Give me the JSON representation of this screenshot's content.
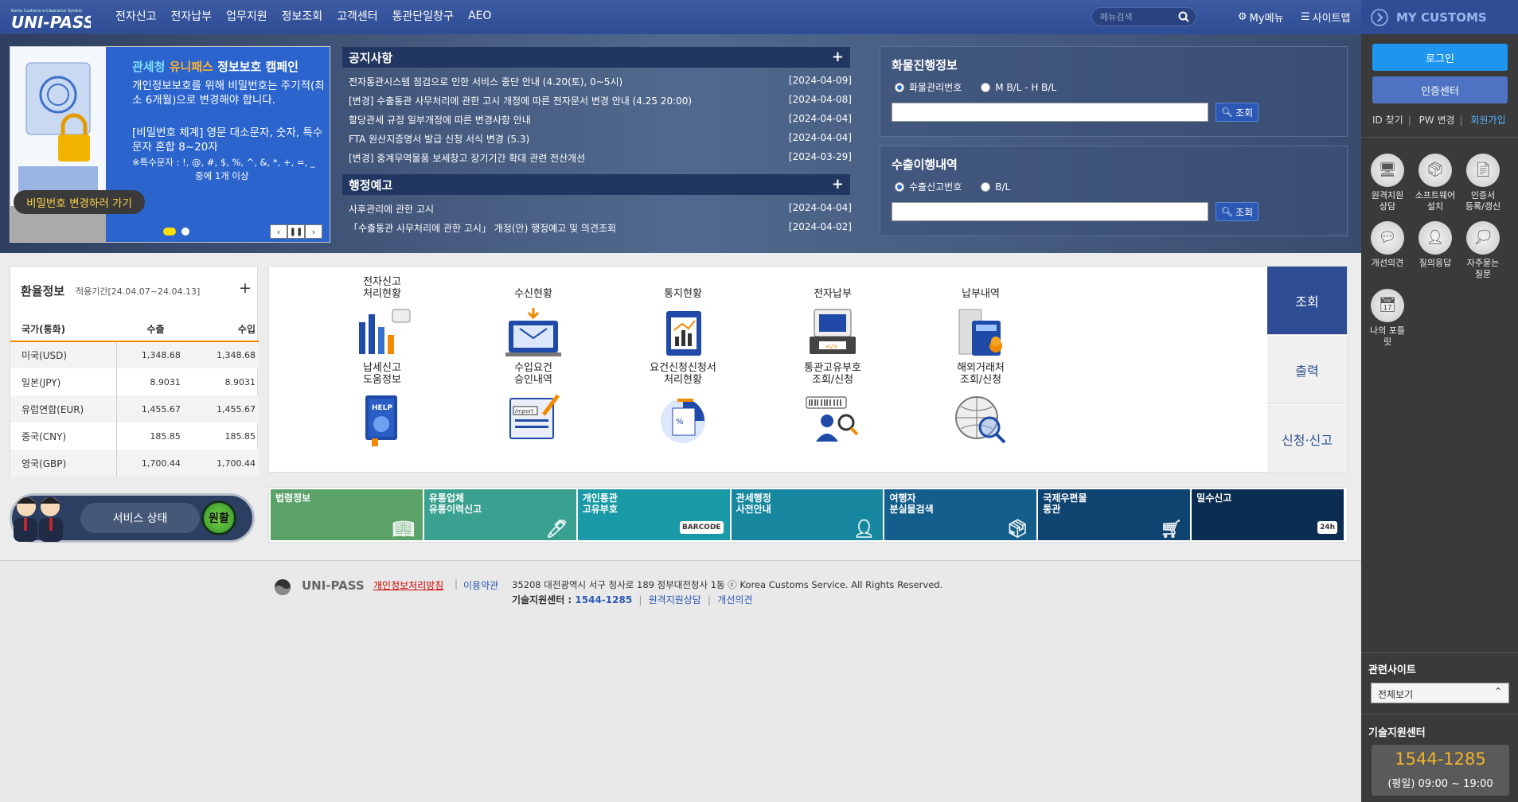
{
  "header": {
    "nav": [
      "전자신고",
      "전자납부",
      "업무지원",
      "정보조회",
      "고객센터",
      "통관단일창구",
      "AEO"
    ],
    "search_placeholder": "메뉴검색",
    "mymenu": "My메뉴",
    "sitemap": "사이트맵"
  },
  "banner": {
    "title_a": "관세청",
    "title_b": "유니패스",
    "title_c": "정보보호 캠페인",
    "line1": "개인정보보호를 위해 비밀번호는 주기적(최소 6개월)으로 변경해야 합니다.",
    "line2": "[비밀번호 체계] 영문 대소문자, 숫자, 특수문자 혼합 8~20자",
    "line3": "※특수문자 : !, @, #, $, %, ^, &, *, +, =, _",
    "line4": "중에 1개 이상",
    "cta": "비밀번호 변경하러 가기"
  },
  "notices": {
    "title": "공지사항",
    "items": [
      {
        "text": "전자통관시스템 점검으로 인한 서비스 중단 안내 (4.20(토), 0~5시)",
        "date": "[2024-04-09]"
      },
      {
        "text": "[변경] 수출통관 사무처리에 관한 고시 개정에 따른 전자문서 변경 안내 (4.25 20:00)",
        "date": "[2024-04-08]"
      },
      {
        "text": "할당관세 규정 일부개정에 따른 변경사항 안내",
        "date": "[2024-04-04]"
      },
      {
        "text": "FTA 원산지증명서 발급 신청 서식 변경 (5.3)",
        "date": "[2024-04-04]"
      },
      {
        "text": "[변경] 중계무역물품 보세창고 장기기간 확대 관련 전산개선",
        "date": "[2024-03-29]"
      }
    ]
  },
  "admin_notice": {
    "title": "행정예고",
    "items": [
      {
        "text": "사후관리에 관한 고시",
        "date": "[2024-04-04]"
      },
      {
        "text": "「수출통관 사무처리에 관한 고시」 개정(안) 행정예고 및 의견조회",
        "date": "[2024-04-02]"
      }
    ]
  },
  "cargo": {
    "title": "화물진행정보",
    "opt1": "화물관리번호",
    "opt2": "M B/L - H B/L",
    "btn": "조회"
  },
  "export": {
    "title": "수출이행내역",
    "opt1": "수출신고번호",
    "opt2": "B/L",
    "btn": "조회"
  },
  "exchange": {
    "title": "환율정보",
    "period": "적용기간[24.04.07~24.04.13]",
    "headers": [
      "국가(통화)",
      "수출",
      "수입"
    ],
    "rows": [
      [
        "미국(USD)",
        "1,348.68",
        "1,348.68"
      ],
      [
        "일본(JPY)",
        "8.9031",
        "8.9031"
      ],
      [
        "유럽연합(EUR)",
        "1,455.67",
        "1,455.67"
      ],
      [
        "중국(CNY)",
        "185.85",
        "185.85"
      ],
      [
        "영국(GBP)",
        "1,700.44",
        "1,700.44"
      ]
    ]
  },
  "quick": {
    "row1": [
      "전자신고\n처리현황",
      "수신현황",
      "통지현황",
      "전자납부",
      "납부내역"
    ],
    "row2": [
      "납세신고\n도움정보",
      "수입요건\n승인내역",
      "요건신청신청서\n처리현황",
      "통관고유부호\n조회/신청",
      "해외거래처\n조회/신청"
    ],
    "tabs": [
      "조회",
      "출력",
      "신청·신고"
    ],
    "icon_text": {
      "help": "HELP",
      "import": "Import"
    }
  },
  "service": {
    "label": "서비스 상태",
    "status": "원활"
  },
  "strip": [
    {
      "label": "법령정보",
      "color": "#5aa267"
    },
    {
      "label": "유통업체\n유통이력신고",
      "color": "#3aa08f"
    },
    {
      "label": "개인통관\n고유부호",
      "color": "#1a9aa6",
      "tag": "BARCODE"
    },
    {
      "label": "관세행정\n사전안내",
      "color": "#1787a0"
    },
    {
      "label": "여행자\n분실물검색",
      "color": "#135e8a"
    },
    {
      "label": "국제우편물\n통관",
      "color": "#0f4470"
    },
    {
      "label": "밀수신고",
      "color": "#0b2d52",
      "tag": "24h"
    }
  ],
  "footer": {
    "brand": "UNI-PASS",
    "privacy": "개인정보처리방침",
    "terms": "이용약관",
    "address": "35208 대전광역시 서구 청사로 189 정부대전청사 1동 ⓒ Korea Customs Service. All Rights Reserved.",
    "tech_label": "기술지원센터 :",
    "tech_phone": "1544-1285",
    "remote": "원격지원상담",
    "improve": "개선의견"
  },
  "sidebar": {
    "title": "MY CUSTOMS",
    "login": "로그인",
    "cert": "인증센터",
    "links": [
      "ID 찾기",
      "PW 변경",
      "회원가입"
    ],
    "quick": [
      "원격지원\n상담",
      "소프트웨어\n설치",
      "인증서\n등록/갱신",
      "개선의견",
      "질의응답",
      "자주묻는\n질문",
      "나의 포틀\n릿"
    ],
    "related_title": "관련사이트",
    "related_select": "전체보기",
    "support_title": "기술지원센터",
    "support_phone": "1544-1285",
    "support_hours": "(평일) 09:00 ~ 19:00"
  },
  "colors": {
    "brand": "#2f4d94",
    "accent": "#f08a00",
    "login": "#1e96f0"
  }
}
